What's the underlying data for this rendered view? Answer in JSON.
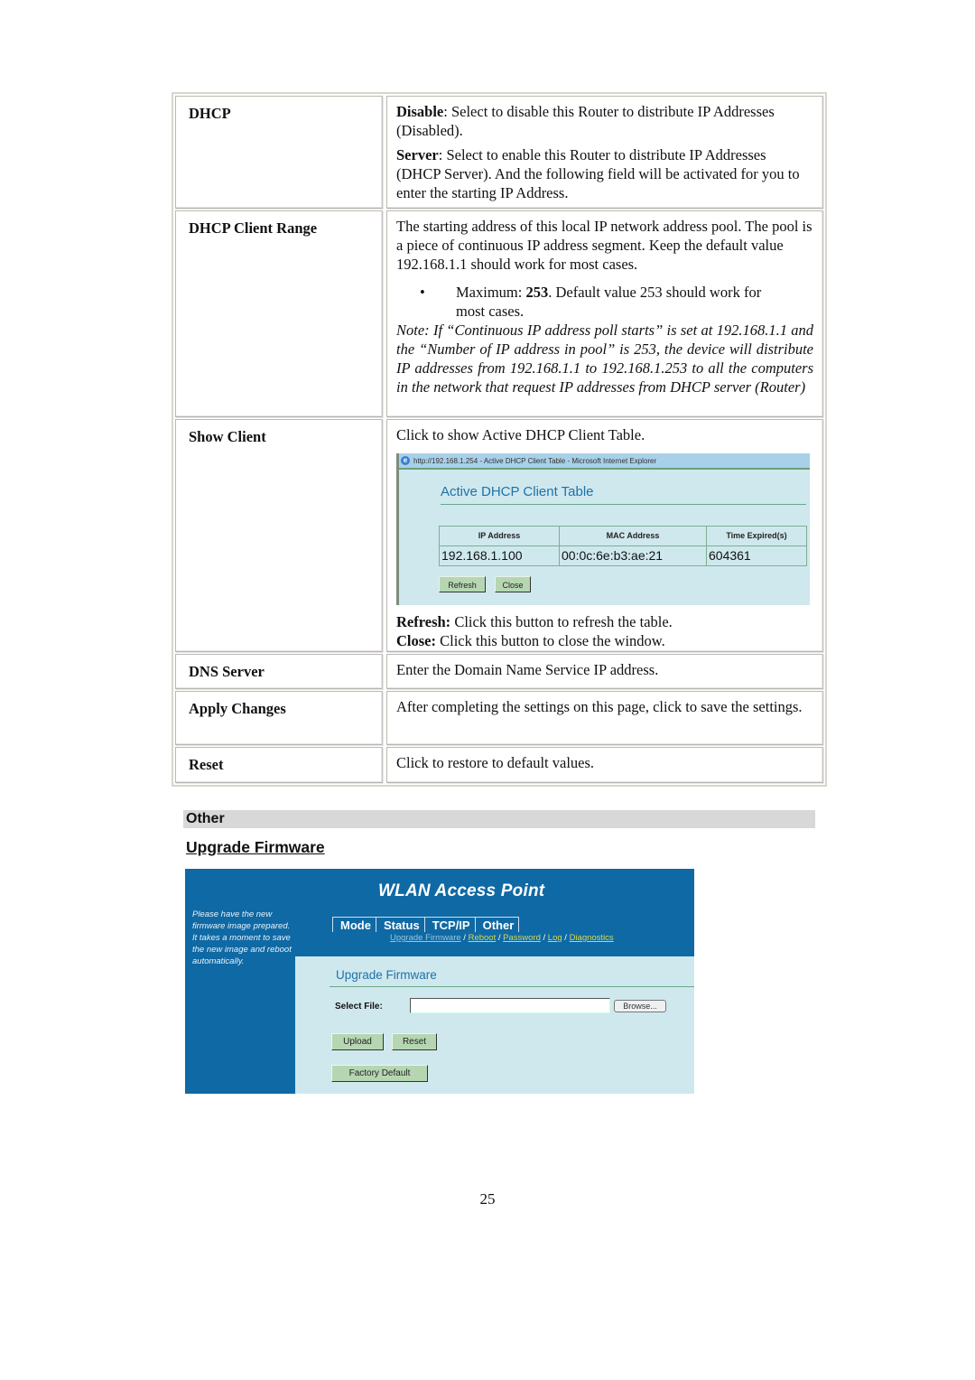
{
  "params_table": {
    "rows": [
      {
        "label": "DHCP",
        "desc": {
          "p1_bold": "Disable",
          "p1_text": ": Select to disable this Router to distribute IP Addresses (Disabled).",
          "p2_bold": "Server",
          "p2_text": ": Select to enable this Router to distribute IP Addresses (DHCP Server). And the following field will be activated for you to enter the starting IP Address."
        }
      },
      {
        "label": "DHCP Client Range",
        "desc": {
          "p1": "The starting address of this local IP network address pool. The pool is a piece of continuous IP address segment. Keep the default value 192.168.1.1 should work for most cases.",
          "bullet_symbol": "•",
          "bullet_pre": "Maximum: ",
          "bullet_bold": "253",
          "bullet_post": ".  Default value 253 should work for most cases.",
          "note": "Note: If “Continuous IP address poll starts” is set at 192.168.1.1 and the “Number of IP address in pool” is 253, the device will distribute IP addresses from 192.168.1.1 to 192.168.1.253 to all the computers in the network that request IP addresses from DHCP server (Router)"
        }
      },
      {
        "label": "Show Client",
        "desc": {
          "p1": "Click to show Active DHCP Client Table.",
          "refresh_bold": "Refresh:",
          "refresh_text": " Click this button to refresh the table.",
          "close_bold": "Close:",
          "close_text": " Click this button to close the window."
        }
      },
      {
        "label": "DNS Server",
        "desc": {
          "p1": "Enter the Domain Name Service IP address."
        }
      },
      {
        "label": "Apply Changes",
        "desc": {
          "p1": "After completing the settings on this page, click to save the settings."
        }
      },
      {
        "label": "Reset",
        "desc": {
          "p1": "Click  to restore to default values."
        }
      }
    ]
  },
  "dhcp_popup": {
    "window_title": "http://192.168.1.254 - Active DHCP Client Table - Microsoft Internet Explorer",
    "icon": "ie-icon",
    "heading": "Active DHCP Client Table",
    "columns": [
      "IP Address",
      "MAC Address",
      "Time Expired(s)"
    ],
    "rows": [
      [
        "192.168.1.100",
        "00:0c:6e:b3:ae:21",
        "604361"
      ]
    ],
    "buttons": {
      "refresh": "Refresh",
      "close": "Close"
    }
  },
  "section": {
    "title": "Other",
    "subheading": "Upgrade Firmware"
  },
  "wlan": {
    "brand": "WLAN Access Point",
    "tabs": [
      "Mode",
      "Status",
      "TCP/IP",
      "Other"
    ],
    "sublinks": [
      "Upgrade Firmware",
      "Reboot",
      "Password",
      "Log",
      "Diagnostics"
    ],
    "separator": " / ",
    "side_note": "Please have the new firmware image prepared. It takes a moment to save the new image and reboot automatically.",
    "page_title": "Upgrade Firmware",
    "select_file_label": "Select File:",
    "file_value": "",
    "browse_label": "Browse...",
    "upload_label": "Upload",
    "reset_label": "Reset",
    "factory_default_label": "Factory Default",
    "colors": {
      "header_blue": "#0f69a4",
      "content_bg": "#cfe8ee",
      "link_yellow": "#d8d84a",
      "button_green": "#b6d6b2"
    }
  },
  "page_number": "25"
}
